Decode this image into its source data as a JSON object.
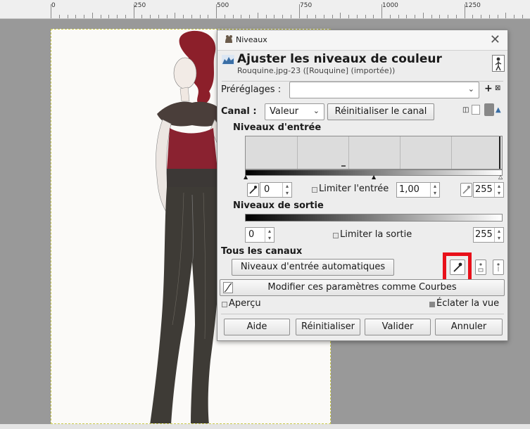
{
  "ruler": {
    "labels": [
      "0",
      "250",
      "500",
      "750",
      "1000",
      "1250"
    ]
  },
  "dialog": {
    "title": "Niveaux",
    "heading": "Ajuster les niveaux de couleur",
    "subheading": "Rouquine.jpg-23 ([Rouquine] (importée))",
    "presets_label": "Préréglages :",
    "presets_value": "",
    "channel_label": "Canal :",
    "channel_value": "Valeur",
    "reset_channel": "Réinitialiser le canal",
    "input_levels": "Niveaux d'entrée",
    "input_low": "0",
    "limit_input": "Limiter l'entrée",
    "input_gamma": "1,00",
    "input_high": "255",
    "output_levels": "Niveaux de sortie",
    "output_low": "0",
    "limit_output": "Limiter la sortie",
    "output_high": "255",
    "all_channels": "Tous les canaux",
    "auto_input": "Niveaux d'entrée automatiques",
    "edit_curves": "Modifier ces paramètres comme Courbes",
    "preview": "Aperçu",
    "split_view": "Éclater la vue",
    "help": "Aide",
    "reset": "Réinitialiser",
    "ok": "Valider",
    "cancel": "Annuler"
  },
  "colors": {
    "highlight": "#e8101a",
    "accent": "#3a6ea5"
  }
}
